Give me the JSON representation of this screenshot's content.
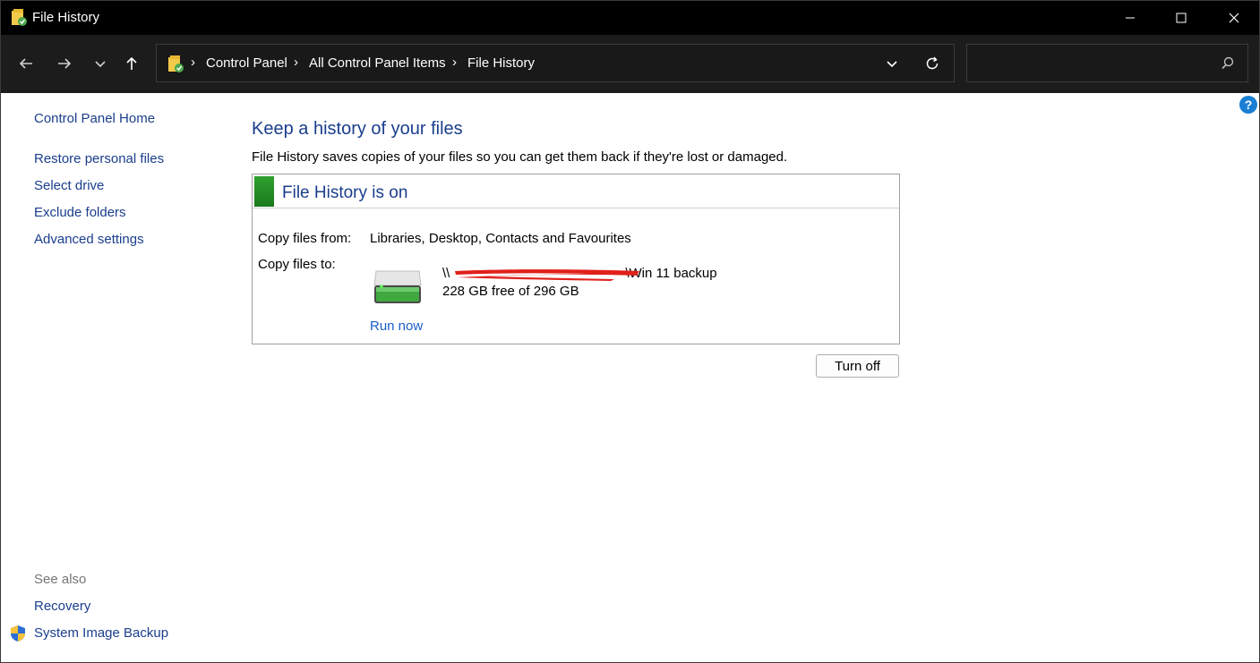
{
  "window": {
    "title": "File History",
    "controls": [
      "minimize-icon",
      "maximize-icon",
      "close-icon"
    ]
  },
  "address": {
    "breadcrumbs": [
      "Control Panel",
      "All Control Panel Items",
      "File History"
    ],
    "separator": "›",
    "search_placeholder": ""
  },
  "sidebar": {
    "home": "Control Panel Home",
    "links": [
      "Restore personal files",
      "Select drive",
      "Exclude folders",
      "Advanced settings"
    ],
    "see_also_label": "See also",
    "see_also": [
      "Recovery",
      "System Image Backup"
    ]
  },
  "main": {
    "title": "Keep a history of your files",
    "description": "File History saves copies of your files so you can get them back if they're lost or damaged.",
    "status": {
      "title": "File History is on",
      "status_color": "#2fa02f",
      "copy_from_label": "Copy files from:",
      "copy_from_value": "Libraries, Desktop, Contacts and Favourites",
      "copy_to_label": "Copy files to:",
      "drive_path_prefix": "\\\\",
      "drive_path_suffix": "\\Win 11 backup",
      "drive_free": "228 GB free of 296 GB",
      "run_now": "Run now"
    },
    "turn_off": "Turn off"
  },
  "help": {
    "label": "?"
  }
}
